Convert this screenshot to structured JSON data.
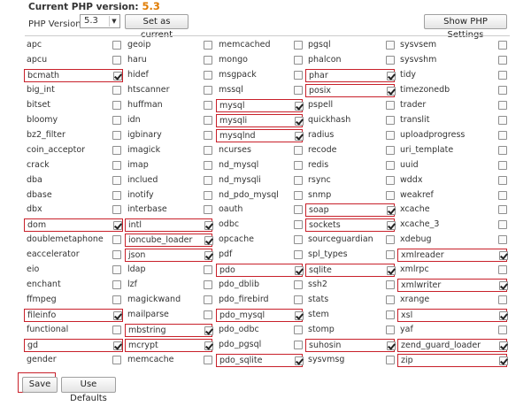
{
  "header": {
    "title": "Current PHP version:",
    "version": "5.3",
    "version_label": "PHP Version",
    "selected_version": "5.3",
    "set_button": "Set as current",
    "show_settings_button": "Show PHP Settings"
  },
  "extensions": [
    [
      {
        "name": "apc",
        "on": false
      },
      {
        "name": "geoip",
        "on": false
      },
      {
        "name": "memcached",
        "on": false
      },
      {
        "name": "pgsql",
        "on": false
      },
      {
        "name": "sysvsem",
        "on": false
      }
    ],
    [
      {
        "name": "apcu",
        "on": false
      },
      {
        "name": "haru",
        "on": false
      },
      {
        "name": "mongo",
        "on": false
      },
      {
        "name": "phalcon",
        "on": false
      },
      {
        "name": "sysvshm",
        "on": false
      }
    ],
    [
      {
        "name": "bcmath",
        "on": true
      },
      {
        "name": "hidef",
        "on": false
      },
      {
        "name": "msgpack",
        "on": false
      },
      {
        "name": "phar",
        "on": true
      },
      {
        "name": "tidy",
        "on": false
      }
    ],
    [
      {
        "name": "big_int",
        "on": false
      },
      {
        "name": "htscanner",
        "on": false
      },
      {
        "name": "mssql",
        "on": false
      },
      {
        "name": "posix",
        "on": true
      },
      {
        "name": "timezonedb",
        "on": false
      }
    ],
    [
      {
        "name": "bitset",
        "on": false
      },
      {
        "name": "huffman",
        "on": false
      },
      {
        "name": "mysql",
        "on": true
      },
      {
        "name": "pspell",
        "on": false
      },
      {
        "name": "trader",
        "on": false
      }
    ],
    [
      {
        "name": "bloomy",
        "on": false
      },
      {
        "name": "idn",
        "on": false
      },
      {
        "name": "mysqli",
        "on": true
      },
      {
        "name": "quickhash",
        "on": false
      },
      {
        "name": "translit",
        "on": false
      }
    ],
    [
      {
        "name": "bz2_filter",
        "on": false
      },
      {
        "name": "igbinary",
        "on": false
      },
      {
        "name": "mysqlnd",
        "on": true
      },
      {
        "name": "radius",
        "on": false
      },
      {
        "name": "uploadprogress",
        "on": false
      }
    ],
    [
      {
        "name": "coin_acceptor",
        "on": false
      },
      {
        "name": "imagick",
        "on": false
      },
      {
        "name": "ncurses",
        "on": false
      },
      {
        "name": "recode",
        "on": false
      },
      {
        "name": "uri_template",
        "on": false
      }
    ],
    [
      {
        "name": "crack",
        "on": false
      },
      {
        "name": "imap",
        "on": false
      },
      {
        "name": "nd_mysql",
        "on": false
      },
      {
        "name": "redis",
        "on": false
      },
      {
        "name": "uuid",
        "on": false
      }
    ],
    [
      {
        "name": "dba",
        "on": false
      },
      {
        "name": "inclued",
        "on": false
      },
      {
        "name": "nd_mysqli",
        "on": false
      },
      {
        "name": "rsync",
        "on": false
      },
      {
        "name": "wddx",
        "on": false
      }
    ],
    [
      {
        "name": "dbase",
        "on": false
      },
      {
        "name": "inotify",
        "on": false
      },
      {
        "name": "nd_pdo_mysql",
        "on": false
      },
      {
        "name": "snmp",
        "on": false
      },
      {
        "name": "weakref",
        "on": false
      }
    ],
    [
      {
        "name": "dbx",
        "on": false
      },
      {
        "name": "interbase",
        "on": false
      },
      {
        "name": "oauth",
        "on": false
      },
      {
        "name": "soap",
        "on": true
      },
      {
        "name": "xcache",
        "on": false
      }
    ],
    [
      {
        "name": "dom",
        "on": true
      },
      {
        "name": "intl",
        "on": true
      },
      {
        "name": "odbc",
        "on": false
      },
      {
        "name": "sockets",
        "on": true
      },
      {
        "name": "xcache_3",
        "on": false
      }
    ],
    [
      {
        "name": "doublemetaphone",
        "on": false
      },
      {
        "name": "ioncube_loader",
        "on": true
      },
      {
        "name": "opcache",
        "on": false
      },
      {
        "name": "sourceguardian",
        "on": false
      },
      {
        "name": "xdebug",
        "on": false
      }
    ],
    [
      {
        "name": "eaccelerator",
        "on": false
      },
      {
        "name": "json",
        "on": true
      },
      {
        "name": "pdf",
        "on": false
      },
      {
        "name": "spl_types",
        "on": false
      },
      {
        "name": "xmlreader",
        "on": true
      }
    ],
    [
      {
        "name": "eio",
        "on": false
      },
      {
        "name": "ldap",
        "on": false
      },
      {
        "name": "pdo",
        "on": true
      },
      {
        "name": "sqlite",
        "on": true
      },
      {
        "name": "xmlrpc",
        "on": false
      }
    ],
    [
      {
        "name": "enchant",
        "on": false
      },
      {
        "name": "lzf",
        "on": false
      },
      {
        "name": "pdo_dblib",
        "on": false
      },
      {
        "name": "ssh2",
        "on": false
      },
      {
        "name": "xmlwriter",
        "on": true
      }
    ],
    [
      {
        "name": "ffmpeg",
        "on": false
      },
      {
        "name": "magickwand",
        "on": false
      },
      {
        "name": "pdo_firebird",
        "on": false
      },
      {
        "name": "stats",
        "on": false
      },
      {
        "name": "xrange",
        "on": false
      }
    ],
    [
      {
        "name": "fileinfo",
        "on": true
      },
      {
        "name": "mailparse",
        "on": false
      },
      {
        "name": "pdo_mysql",
        "on": true
      },
      {
        "name": "stem",
        "on": false
      },
      {
        "name": "xsl",
        "on": true
      }
    ],
    [
      {
        "name": "functional",
        "on": false
      },
      {
        "name": "mbstring",
        "on": true
      },
      {
        "name": "pdo_odbc",
        "on": false
      },
      {
        "name": "stomp",
        "on": false
      },
      {
        "name": "yaf",
        "on": false
      }
    ],
    [
      {
        "name": "gd",
        "on": true
      },
      {
        "name": "mcrypt",
        "on": true
      },
      {
        "name": "pdo_pgsql",
        "on": false
      },
      {
        "name": "suhosin",
        "on": true
      },
      {
        "name": "zend_guard_loader",
        "on": true
      }
    ],
    [
      {
        "name": "gender",
        "on": false
      },
      {
        "name": "memcache",
        "on": false
      },
      {
        "name": "pdo_sqlite",
        "on": true
      },
      {
        "name": "sysvmsg",
        "on": false
      },
      {
        "name": "zip",
        "on": true
      }
    ]
  ],
  "footer": {
    "save_button": "Save",
    "defaults_button": "Use Defaults"
  }
}
